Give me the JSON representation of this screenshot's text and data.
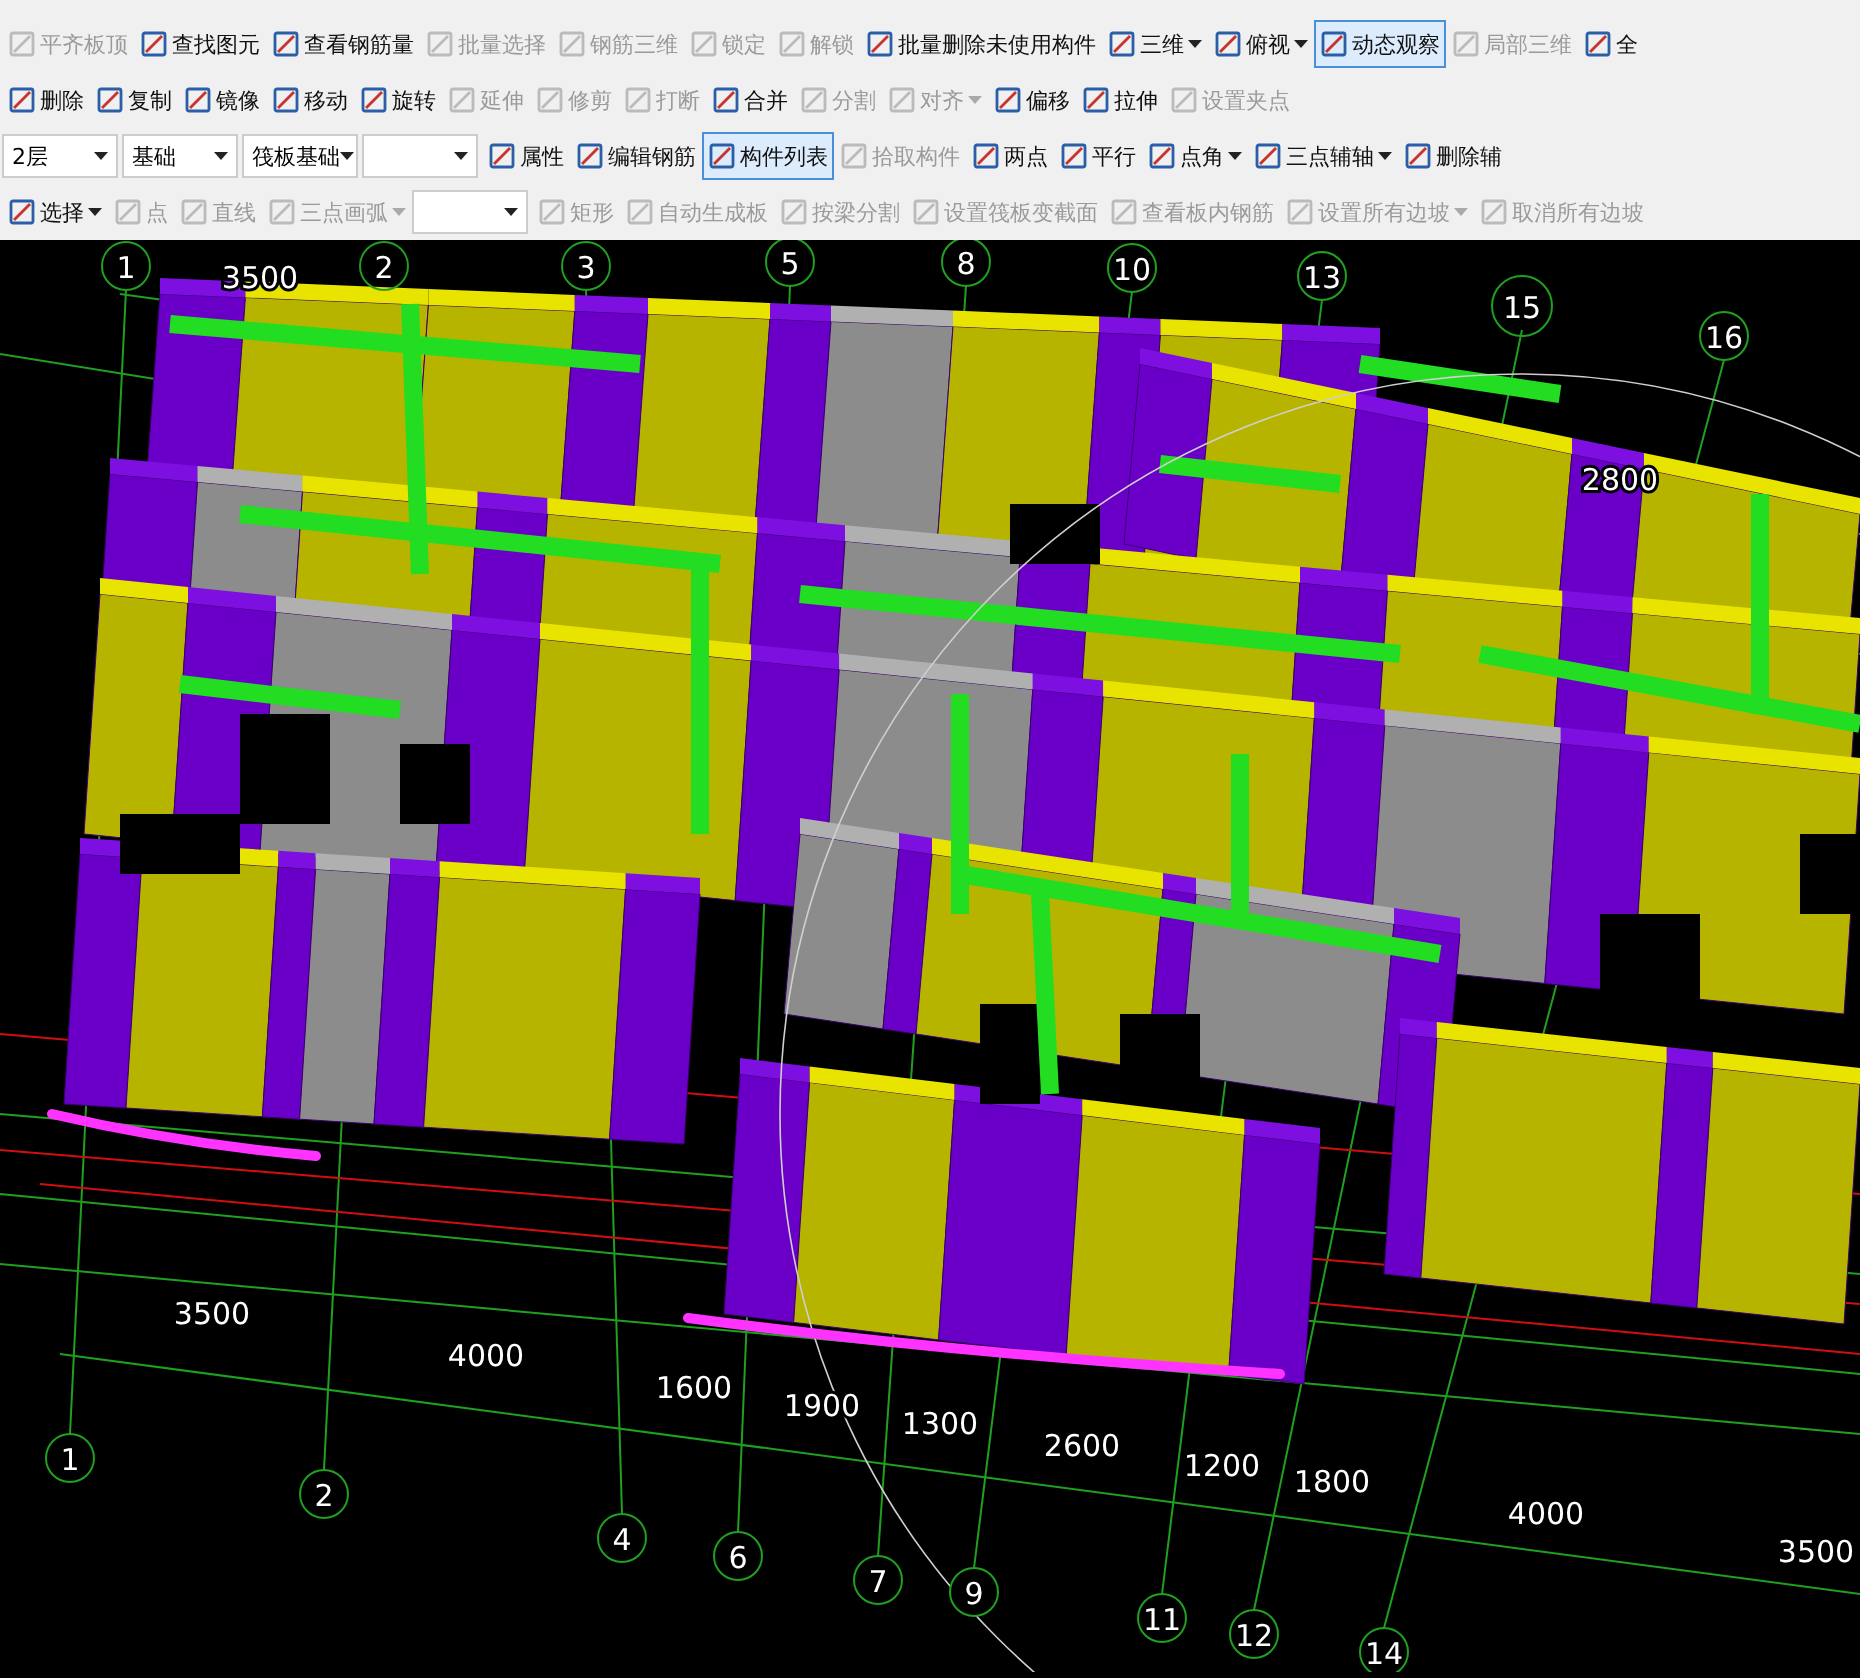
{
  "toolbars": [
    {
      "items": [
        {
          "kind": "button",
          "label": "平齐板顶",
          "disabled": true,
          "selected": false
        },
        {
          "kind": "button",
          "label": "查找图元",
          "disabled": false,
          "selected": false
        },
        {
          "kind": "button",
          "label": "查看钢筋量",
          "disabled": false,
          "selected": false
        },
        {
          "kind": "button",
          "label": "批量选择",
          "disabled": true,
          "selected": false
        },
        {
          "kind": "button",
          "label": "钢筋三维",
          "disabled": true,
          "selected": false
        },
        {
          "kind": "button",
          "label": "锁定",
          "disabled": true,
          "selected": false
        },
        {
          "kind": "button",
          "label": "解锁",
          "disabled": true,
          "selected": false
        },
        {
          "kind": "button",
          "label": "批量删除未使用构件",
          "disabled": false,
          "selected": false
        },
        {
          "kind": "dropdown",
          "label": "三维",
          "disabled": false,
          "selected": false
        },
        {
          "kind": "dropdown",
          "label": "俯视",
          "disabled": false,
          "selected": false
        },
        {
          "kind": "button",
          "label": "动态观察",
          "disabled": false,
          "selected": true
        },
        {
          "kind": "button",
          "label": "局部三维",
          "disabled": true,
          "selected": false
        },
        {
          "kind": "button",
          "label": "全",
          "disabled": false,
          "selected": false
        }
      ]
    },
    {
      "items": [
        {
          "kind": "button",
          "label": "删除",
          "disabled": false,
          "selected": false
        },
        {
          "kind": "button",
          "label": "复制",
          "disabled": false,
          "selected": false
        },
        {
          "kind": "button",
          "label": "镜像",
          "disabled": false,
          "selected": false
        },
        {
          "kind": "button",
          "label": "移动",
          "disabled": false,
          "selected": false
        },
        {
          "kind": "button",
          "label": "旋转",
          "disabled": false,
          "selected": false
        },
        {
          "kind": "button",
          "label": "延伸",
          "disabled": true,
          "selected": false
        },
        {
          "kind": "button",
          "label": "修剪",
          "disabled": true,
          "selected": false
        },
        {
          "kind": "button",
          "label": "打断",
          "disabled": true,
          "selected": false
        },
        {
          "kind": "button",
          "label": "合并",
          "disabled": false,
          "selected": false
        },
        {
          "kind": "button",
          "label": "分割",
          "disabled": true,
          "selected": false
        },
        {
          "kind": "dropdown",
          "label": "对齐",
          "disabled": true,
          "selected": false
        },
        {
          "kind": "button",
          "label": "偏移",
          "disabled": false,
          "selected": false
        },
        {
          "kind": "button",
          "label": "拉伸",
          "disabled": false,
          "selected": false
        },
        {
          "kind": "button",
          "label": "设置夹点",
          "disabled": true,
          "selected": false
        }
      ]
    },
    {
      "items": [
        {
          "kind": "select",
          "value": "2层"
        },
        {
          "kind": "select",
          "value": "基础"
        },
        {
          "kind": "select",
          "value": "筏板基础"
        },
        {
          "kind": "select"
        },
        {
          "kind": "button",
          "label": "属性",
          "disabled": false,
          "selected": false
        },
        {
          "kind": "button",
          "label": "编辑钢筋",
          "disabled": false,
          "selected": false
        },
        {
          "kind": "button",
          "label": "构件列表",
          "disabled": false,
          "selected": true
        },
        {
          "kind": "button",
          "label": "拾取构件",
          "disabled": true,
          "selected": false
        },
        {
          "kind": "button",
          "label": "两点",
          "disabled": false,
          "selected": false
        },
        {
          "kind": "button",
          "label": "平行",
          "disabled": false,
          "selected": false
        },
        {
          "kind": "dropdown",
          "label": "点角",
          "disabled": false,
          "selected": false
        },
        {
          "kind": "dropdown",
          "label": "三点辅轴",
          "disabled": false,
          "selected": false
        },
        {
          "kind": "button",
          "label": "删除辅",
          "disabled": false,
          "selected": false
        }
      ]
    },
    {
      "items": [
        {
          "kind": "dropdown",
          "label": "选择",
          "disabled": false,
          "selected": false
        },
        {
          "kind": "button",
          "label": "点",
          "disabled": true,
          "selected": false
        },
        {
          "kind": "button",
          "label": "直线",
          "disabled": true,
          "selected": false
        },
        {
          "kind": "dropdown",
          "label": "三点画弧",
          "disabled": true,
          "selected": false
        },
        {
          "kind": "select"
        },
        {
          "kind": "button",
          "label": "矩形",
          "disabled": true,
          "selected": false
        },
        {
          "kind": "button",
          "label": "自动生成板",
          "disabled": true,
          "selected": false
        },
        {
          "kind": "button",
          "label": "按梁分割",
          "disabled": true,
          "selected": false
        },
        {
          "kind": "button",
          "label": "设置筏板变截面",
          "disabled": true,
          "selected": false
        },
        {
          "kind": "button",
          "label": "查看板内钢筋",
          "disabled": true,
          "selected": false
        },
        {
          "kind": "dropdown",
          "label": "设置所有边坡",
          "disabled": true,
          "selected": false
        },
        {
          "kind": "button",
          "label": "取消所有边坡",
          "disabled": true,
          "selected": false
        }
      ]
    }
  ],
  "viewport": {
    "top_axes": [
      "1",
      "2",
      "3",
      "5",
      "8",
      "10",
      "13",
      "15",
      "16"
    ],
    "bottom_axes": [
      "1",
      "2",
      "4",
      "6",
      "7",
      "9",
      "11",
      "12",
      "14"
    ],
    "top_dimensions": [
      "3500",
      "2800"
    ],
    "bottom_dimensions": [
      "3500",
      "4000",
      "1600",
      "1900",
      "1300",
      "2600",
      "1200",
      "1800",
      "4000",
      "3500"
    ]
  }
}
